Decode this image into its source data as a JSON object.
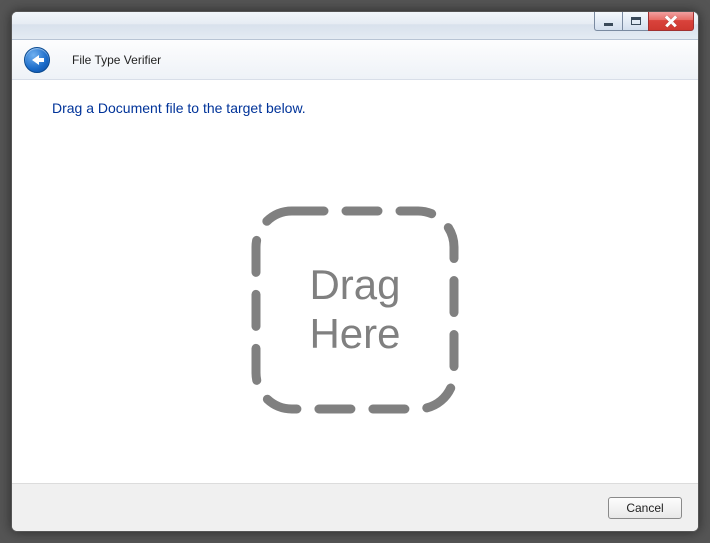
{
  "header": {
    "title": "File Type Verifier"
  },
  "content": {
    "instruction": "Drag a Document file to the target below.",
    "drop_text_line1": "Drag",
    "drop_text_line2": "Here"
  },
  "footer": {
    "cancel_label": "Cancel"
  }
}
